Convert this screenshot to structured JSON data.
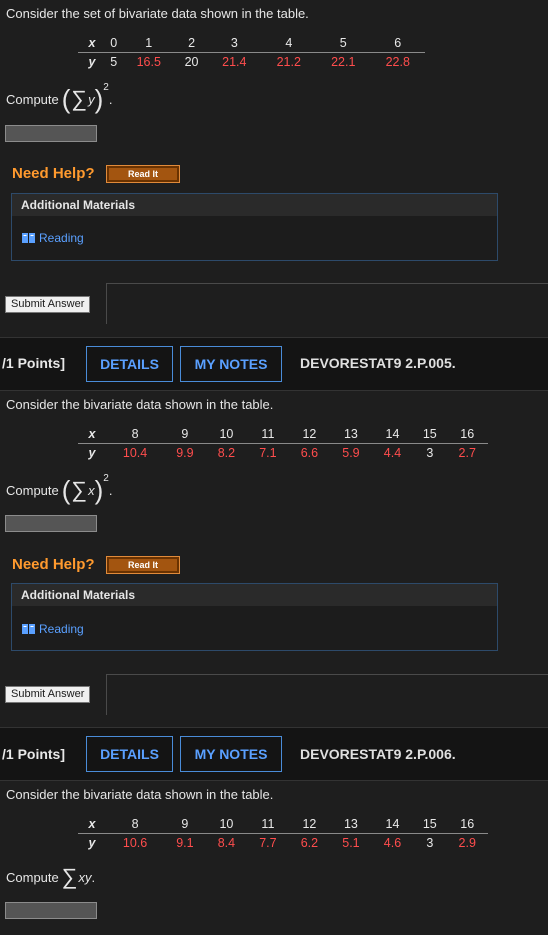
{
  "colors": {
    "accent": "#5aa0ff",
    "value_red": "#ff4d4d",
    "help_orange": "#ff9a2e"
  },
  "q1": {
    "prompt": "Consider the set of bivariate data shown in the table.",
    "x_label": "x",
    "y_label": "y",
    "x": [
      "0",
      "1",
      "2",
      "3",
      "4",
      "5",
      "6"
    ],
    "y": [
      "5",
      "16.5",
      "20",
      "21.4",
      "21.2",
      "22.1",
      "22.8"
    ],
    "compute_label": "Compute",
    "compute_var": "y",
    "compute_exp": "2",
    "compute_end": ".",
    "need_help": "Need Help?",
    "read_it": "Read It",
    "addl_title": "Additional Materials",
    "reading": "Reading",
    "submit": "Submit Answer"
  },
  "q2": {
    "points": "/1 Points]",
    "details": "DETAILS",
    "my_notes": "MY NOTES",
    "code": "DEVORESTAT9 2.P.005.",
    "prompt": "Consider the bivariate data shown in the table.",
    "x_label": "x",
    "y_label": "y",
    "x": [
      "8",
      "9",
      "10",
      "11",
      "12",
      "13",
      "14",
      "15",
      "16"
    ],
    "y": [
      "10.4",
      "9.9",
      "8.2",
      "7.1",
      "6.6",
      "5.9",
      "4.4",
      "3",
      "2.7"
    ],
    "compute_label": "Compute",
    "compute_var": "x",
    "compute_exp": "2",
    "compute_end": ".",
    "need_help": "Need Help?",
    "read_it": "Read It",
    "addl_title": "Additional Materials",
    "reading": "Reading",
    "submit": "Submit Answer"
  },
  "q3": {
    "points": "/1 Points]",
    "details": "DETAILS",
    "my_notes": "MY NOTES",
    "code": "DEVORESTAT9 2.P.006.",
    "prompt": "Consider the bivariate data shown in the table.",
    "x_label": "x",
    "y_label": "y",
    "x": [
      "8",
      "9",
      "10",
      "11",
      "12",
      "13",
      "14",
      "15",
      "16"
    ],
    "y": [
      "10.6",
      "9.1",
      "8.4",
      "7.7",
      "6.2",
      "5.1",
      "4.6",
      "3",
      "2.9"
    ],
    "compute_label": "Compute",
    "compute_var": "xy",
    "compute_end": "."
  }
}
